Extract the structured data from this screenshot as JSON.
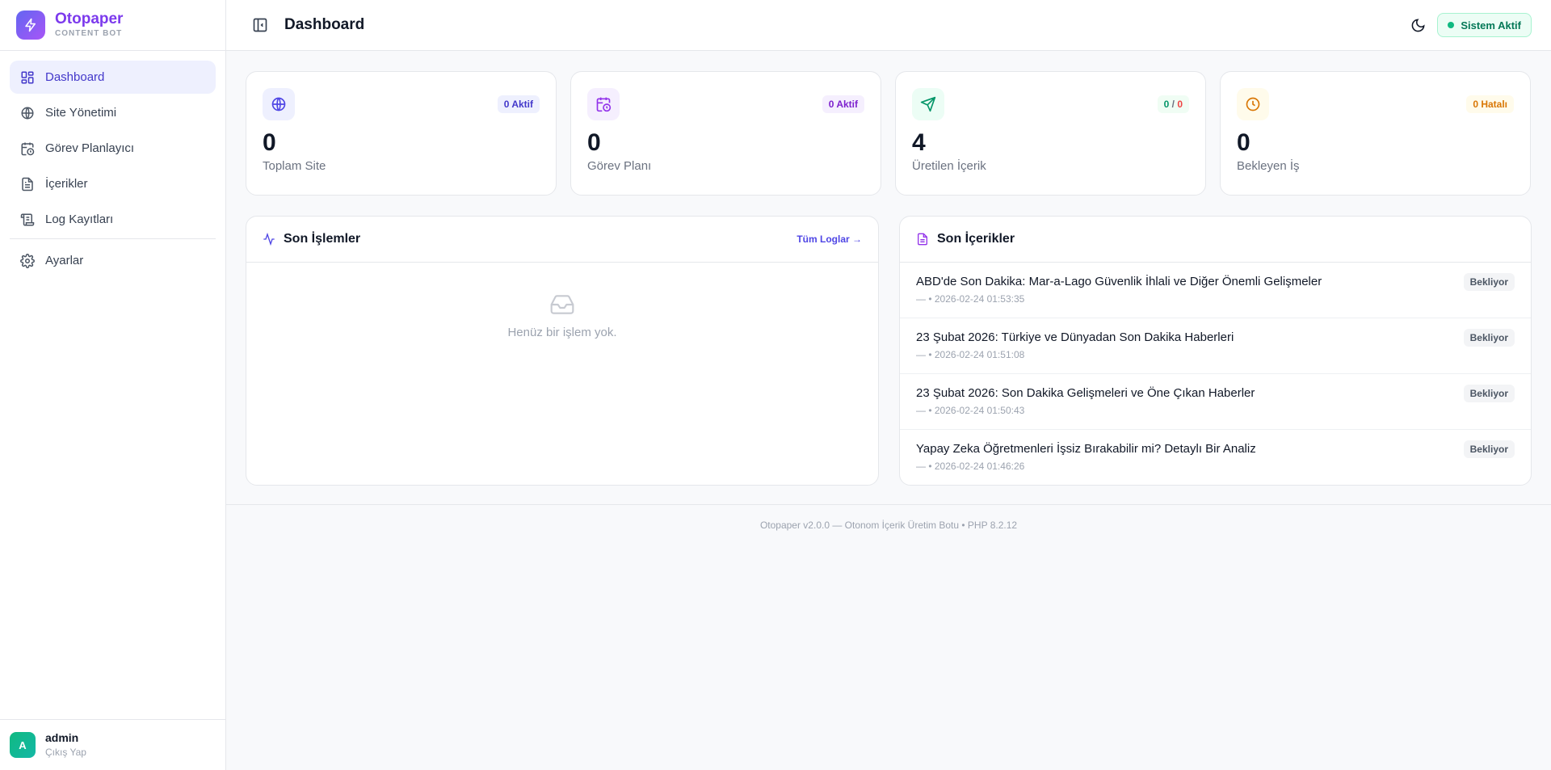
{
  "brand": {
    "name": "Otopaper",
    "subtitle": "CONTENT BOT"
  },
  "sidebar": {
    "items": [
      {
        "label": "Dashboard",
        "icon": "dashboard-icon",
        "active": true
      },
      {
        "label": "Site Yönetimi",
        "icon": "globe-icon"
      },
      {
        "label": "Görev Planlayıcı",
        "icon": "calendar-clock-icon"
      },
      {
        "label": "İçerikler",
        "icon": "document-icon"
      },
      {
        "label": "Log Kayıtları",
        "icon": "scroll-icon"
      },
      {
        "label": "Ayarlar",
        "icon": "gear-icon"
      }
    ]
  },
  "user": {
    "initial": "A",
    "name": "admin",
    "logout": "Çıkış Yap"
  },
  "header": {
    "title": "Dashboard",
    "status": "Sistem Aktif"
  },
  "stats": [
    {
      "value": "0",
      "label": "Toplam Site",
      "badge": "0 Aktif",
      "icon": "globe-icon"
    },
    {
      "value": "0",
      "label": "Görev Planı",
      "badge": "0 Aktif",
      "icon": "calendar-clock-icon"
    },
    {
      "value": "4",
      "label": "Üretilen İçerik",
      "badge_ok": "0",
      "badge_sep": " / ",
      "badge_err": "0",
      "icon": "send-icon"
    },
    {
      "value": "0",
      "label": "Bekleyen İş",
      "badge": "0 Hatalı",
      "icon": "clock-icon"
    }
  ],
  "recent_ops": {
    "title": "Son İşlemler",
    "link": "Tüm Loglar →",
    "empty": "Henüz bir işlem yok."
  },
  "recent_contents": {
    "title": "Son İçerikler",
    "items": [
      {
        "title": "ABD'de Son Dakika: Mar-a-Lago Güvenlik İhlali ve Diğer Önemli Gelişmeler",
        "meta": "— • 2026-02-24 01:53:35",
        "status": "Bekliyor"
      },
      {
        "title": "23 Şubat 2026: Türkiye ve Dünyadan Son Dakika Haberleri",
        "meta": "— • 2026-02-24 01:51:08",
        "status": "Bekliyor"
      },
      {
        "title": "23 Şubat 2026: Son Dakika Gelişmeleri ve Öne Çıkan Haberler",
        "meta": "— • 2026-02-24 01:50:43",
        "status": "Bekliyor"
      },
      {
        "title": "Yapay Zeka Öğretmenleri İşsiz Bırakabilir mi? Detaylı Bir Analiz",
        "meta": "— • 2026-02-24 01:46:26",
        "status": "Bekliyor"
      }
    ]
  },
  "footer": {
    "text": "Otopaper v2.0.0 — Otonom İçerik Üretim Botu • PHP 8.2.12"
  },
  "colors": {
    "accent": "#4f46e5",
    "brand": "#7c3aed",
    "success": "#10b981",
    "warning": "#d97706",
    "danger": "#ef4444"
  }
}
